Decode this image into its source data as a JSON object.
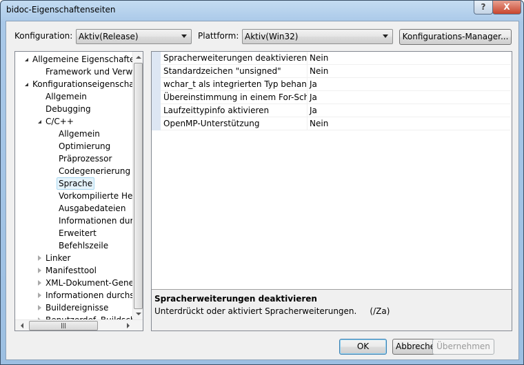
{
  "window": {
    "title": "bidoc-Eigenschaftenseiten",
    "help_label": "?",
    "close_label": "X"
  },
  "toolbar": {
    "config_label": "Konfiguration:",
    "config_value": "Aktiv(Release)",
    "platform_label": "Plattform:",
    "platform_value": "Aktiv(Win32)",
    "manager_label": "Konfigurations-Manager..."
  },
  "tree": {
    "items": [
      {
        "label": "Allgemeine Eigenschaften",
        "level": 0,
        "state": "open"
      },
      {
        "label": "Framework und Verweise",
        "level": 1,
        "state": "none"
      },
      {
        "label": "Konfigurationseigenschaften",
        "level": 0,
        "state": "open"
      },
      {
        "label": "Allgemein",
        "level": 1,
        "state": "none"
      },
      {
        "label": "Debugging",
        "level": 1,
        "state": "none"
      },
      {
        "label": "C/C++",
        "level": 1,
        "state": "open"
      },
      {
        "label": "Allgemein",
        "level": 2,
        "state": "none"
      },
      {
        "label": "Optimierung",
        "level": 2,
        "state": "none"
      },
      {
        "label": "Präprozessor",
        "level": 2,
        "state": "none"
      },
      {
        "label": "Codegenerierung",
        "level": 2,
        "state": "none"
      },
      {
        "label": "Sprache",
        "level": 2,
        "state": "none",
        "selected": true
      },
      {
        "label": "Vorkompilierte Header",
        "level": 2,
        "state": "none"
      },
      {
        "label": "Ausgabedateien",
        "level": 2,
        "state": "none"
      },
      {
        "label": "Informationen durchsuchen",
        "level": 2,
        "state": "none"
      },
      {
        "label": "Erweitert",
        "level": 2,
        "state": "none"
      },
      {
        "label": "Befehlszeile",
        "level": 2,
        "state": "none"
      },
      {
        "label": "Linker",
        "level": 1,
        "state": "closed"
      },
      {
        "label": "Manifesttool",
        "level": 1,
        "state": "closed"
      },
      {
        "label": "XML-Dokument-Generator",
        "level": 1,
        "state": "closed"
      },
      {
        "label": "Informationen durchsuchen",
        "level": 1,
        "state": "closed"
      },
      {
        "label": "Buildereignisse",
        "level": 1,
        "state": "closed"
      },
      {
        "label": "Benutzerdef. Buildschritt",
        "level": 1,
        "state": "closed"
      }
    ]
  },
  "grid": {
    "rows": [
      {
        "name": "Spracherweiterungen deaktivieren",
        "value": "Nein"
      },
      {
        "name": "Standardzeichen \"unsigned\"",
        "value": "Nein"
      },
      {
        "name": "wchar_t als integrierten Typ behandeln",
        "value": "Ja"
      },
      {
        "name": "Übereinstimmung in einem For-Schleifenbereich erzwingen",
        "value": "Ja"
      },
      {
        "name": "Laufzeittypinfo aktivieren",
        "value": "Ja"
      },
      {
        "name": "OpenMP-Unterstützung",
        "value": "Nein"
      }
    ]
  },
  "description": {
    "title": "Spracherweiterungen deaktivieren",
    "text": "Unterdrückt oder aktiviert Spracherweiterungen.     (/Za)"
  },
  "buttons": {
    "ok": "OK",
    "cancel": "Abbrechen",
    "apply": "Übernehmen"
  }
}
